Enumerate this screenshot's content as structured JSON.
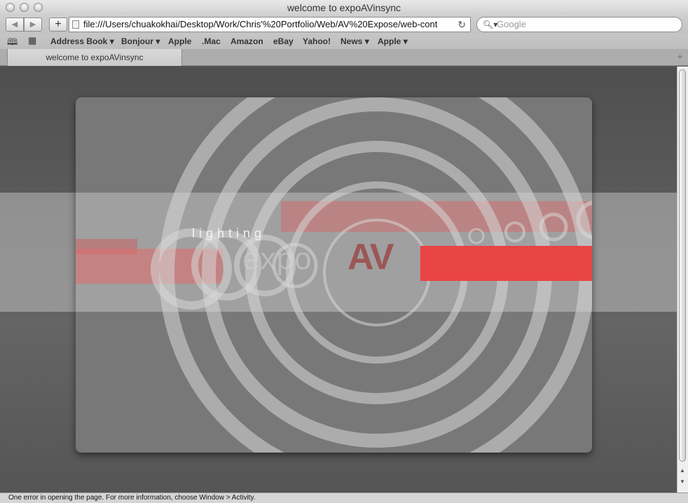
{
  "window": {
    "title": "welcome to expoAVinsync"
  },
  "toolbar": {
    "back_icon": "back-arrow-icon",
    "forward_icon": "forward-arrow-icon",
    "add_icon": "plus-icon",
    "url": "file:///Users/chuakokhai/Desktop/Work/Chris'%20Portfolio/Web/AV%20Expose/web-cont",
    "search_placeholder": "Google"
  },
  "bookmarks": {
    "items": [
      {
        "label": "Address Book",
        "arrow": "▾"
      },
      {
        "label": "Bonjour",
        "arrow": "▾"
      },
      {
        "label": "Apple",
        "arrow": ""
      },
      {
        "label": ".Mac",
        "arrow": ""
      },
      {
        "label": "Amazon",
        "arrow": ""
      },
      {
        "label": "eBay",
        "arrow": ""
      },
      {
        "label": "Yahoo!",
        "arrow": ""
      },
      {
        "label": "News",
        "arrow": "▾"
      },
      {
        "label": "Apple",
        "arrow": "▾"
      }
    ]
  },
  "tabs": [
    {
      "label": "welcome to expoAVinsync"
    }
  ],
  "page": {
    "logo_lighting": "lighting",
    "logo_expo": "expo",
    "logo_av": "AV",
    "accent_color": "#e84444"
  },
  "status": {
    "text": "One error in opening the page. For more information, choose Window > Activity."
  }
}
